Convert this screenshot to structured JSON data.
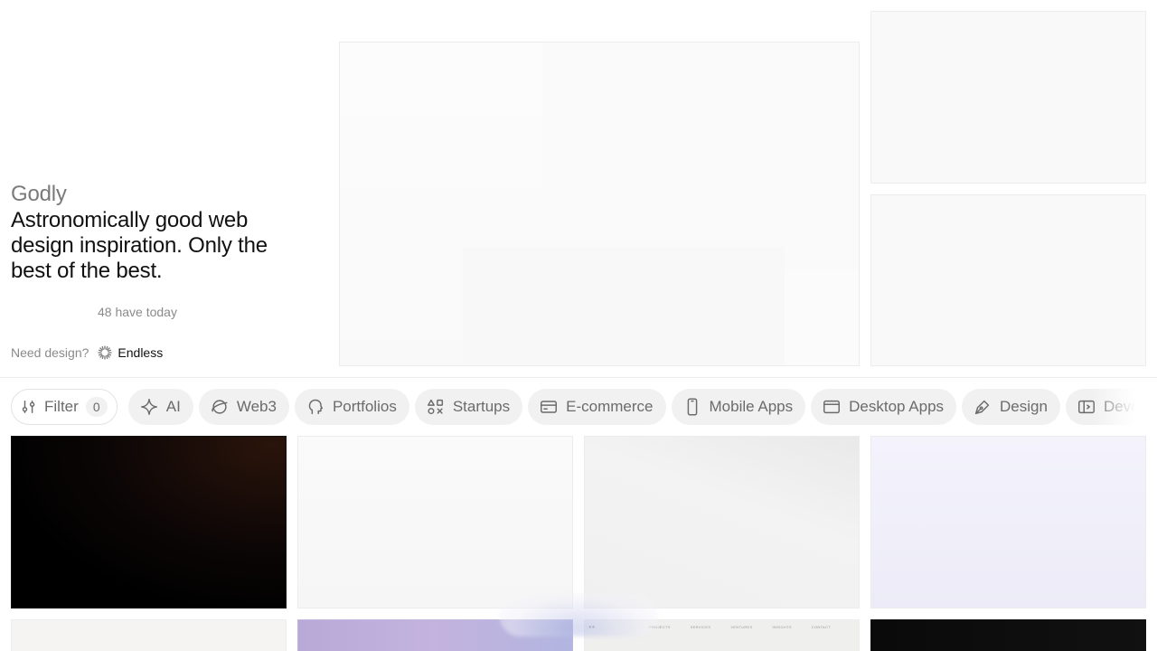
{
  "hero": {
    "brand": "Godly",
    "tagline": "Astronomically good web design inspiration. Only the best of the best.",
    "today_count": "48 have today",
    "need_design": "Need design?",
    "endless_label": "Endless"
  },
  "filter": {
    "label": "Filter",
    "count": "0"
  },
  "categories": [
    {
      "label": "AI",
      "icon": "sparkle-icon"
    },
    {
      "label": "Web3",
      "icon": "planet-icon"
    },
    {
      "label": "Portfolios",
      "icon": "head-icon"
    },
    {
      "label": "Startups",
      "icon": "shapes-icon"
    },
    {
      "label": "E-commerce",
      "icon": "credit-card-icon"
    },
    {
      "label": "Mobile Apps",
      "icon": "phone-icon"
    },
    {
      "label": "Desktop Apps",
      "icon": "browser-window-icon"
    },
    {
      "label": "Design",
      "icon": "pen-nib-icon"
    },
    {
      "label": "Development",
      "icon": "code-window-icon"
    }
  ],
  "thumbnail_nav": {
    "items": [
      "PROJECTS",
      "SERVICES",
      "VENTURES",
      "INSIGHTS",
      "CONTACT"
    ]
  }
}
